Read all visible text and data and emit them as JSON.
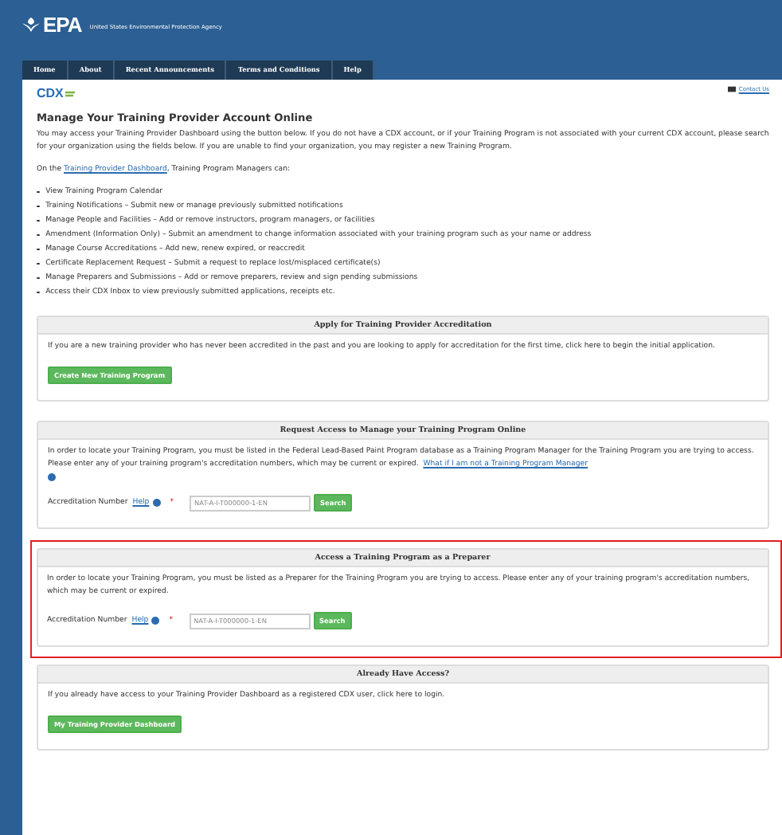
{
  "header": {
    "logo": "EPA",
    "agency": "United States Environmental Protection Agency"
  },
  "nav": [
    {
      "label": "Home"
    },
    {
      "label": "About"
    },
    {
      "label": "Recent Announcements"
    },
    {
      "label": "Terms and Conditions"
    },
    {
      "label": "Help"
    }
  ],
  "cdx_logo": "CDX",
  "contact_link": "Contact Us",
  "title": "Manage Your Training Provider Account Online",
  "intro": "You may access your Training Provider Dashboard using the button below. If you do not have a CDX account, or if your Training Program is not associated with your current CDX account, please search for your organization using the fields below. If you are unable to find your organization, you may register a new Training Program.",
  "managers_line": {
    "before": "On the",
    "link": "Training Provider Dashboard",
    "after": ", Training Program Managers can:"
  },
  "capabilities": [
    "View Training Program Calendar",
    "Training Notifications – Submit new or manage previously submitted notifications",
    "Manage People and Facilities – Add or remove instructors, program managers, or facilities",
    "Amendment (Information Only) – Submit an amendment to change information associated with your training program such as your name or address",
    "Manage Course Accreditations – Add new, renew expired, or reaccredit",
    "Certificate Replacement Request – Submit a request to replace lost/misplaced certificate(s)",
    "Manage Preparers and Submissions – Add or remove preparers, review and sign pending submissions",
    "Access their CDX Inbox to view previously submitted applications, receipts etc."
  ],
  "panels": [
    {
      "kind": "button",
      "highlighted": false,
      "title": "Apply for Training Provider Accreditation",
      "text": "If you are a new training provider who has never been accredited in the past and you are looking to apply for accreditation for the first time, click here to begin the initial application.",
      "button": "Create New Training Program"
    },
    {
      "kind": "search",
      "highlighted": false,
      "title": "Request Access to Manage your Training Program Online",
      "text": "In order to locate your Training Program, you must be listed in the Federal Lead-Based Paint Program database as a Training Program Manager for the Training Program you are trying to access. Please enter any of your training program's accreditation numbers, which may be current or expired.",
      "link": "What if I am not a Training Program Manager",
      "label": "Accreditation Number",
      "help": "Help",
      "required": "*",
      "placeholder": "NAT-A-I-T000000-1-EN",
      "button": "Search"
    },
    {
      "kind": "search",
      "highlighted": true,
      "title": "Access a Training Program as a Preparer",
      "text": "In order to locate your Training Program, you must be listed as a Preparer for the Training Program you are trying to access. Please enter any of your training program's accreditation numbers, which may be current or expired.",
      "label": "Accreditation Number",
      "help": "Help",
      "required": "*",
      "placeholder": "NAT-A-I-T000000-1-EN",
      "button": "Search"
    },
    {
      "kind": "button",
      "highlighted": false,
      "title": "Already Have Access?",
      "text": "If you already have access to your Training Provider Dashboard as a registered CDX user, click here to login.",
      "button": "My Training Provider Dashboard"
    }
  ]
}
